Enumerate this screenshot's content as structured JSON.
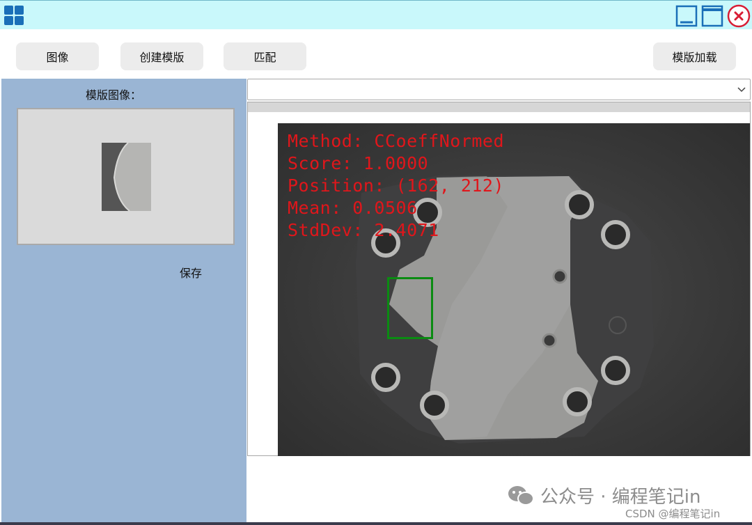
{
  "toolbar": {
    "image_label": "图像",
    "create_template_label": "创建模版",
    "match_label": "匹配",
    "load_template_label": "模版加载"
  },
  "sidebar": {
    "title": "模版图像：",
    "save_label": "保存"
  },
  "combo": {
    "value": ""
  },
  "result": {
    "method": "Method: CCoeffNormed",
    "score": "Score: 1.0000",
    "position": "Position: (162, 212)",
    "mean": "Mean: 0.0506",
    "stddev": "StdDev: 2.4071"
  },
  "watermark": {
    "text": "公众号 · 编程笔记in",
    "csdn": "CSDN @编程笔记in"
  },
  "colors": {
    "titlebar": "#c9f8fb",
    "sidebar": "#9ab5d4",
    "overlay_text": "#e0161b",
    "match_box": "#0b8b12",
    "window_icons": "#1a6fb8",
    "close_icon": "#d81e35"
  },
  "icons": [
    "app-grid-icon",
    "minimize-icon",
    "maximize-icon",
    "close-icon",
    "chevron-down-icon",
    "wechat-icon"
  ]
}
